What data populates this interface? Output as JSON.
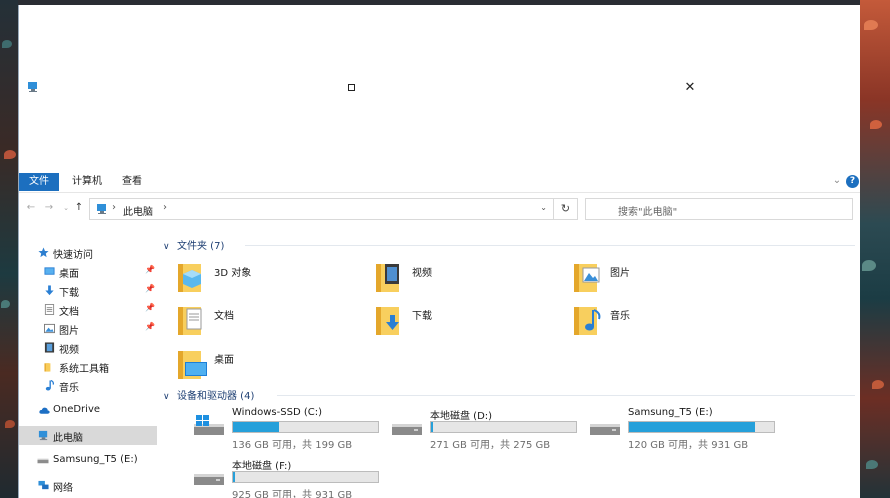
{
  "window": {
    "close_glyph": "✕"
  },
  "ribbon": {
    "tabs": [
      "文件",
      "计算机",
      "查看"
    ],
    "help_glyph": "?",
    "collapse_glyph": "⌄"
  },
  "address_bar": {
    "location": "此电脑",
    "separator": "›",
    "dropdown_glyph": "⌄",
    "refresh_glyph": "↻",
    "back_glyph": "←",
    "forward_glyph": "→",
    "history_glyph": "⌄",
    "up_glyph": "↑"
  },
  "search": {
    "placeholder": "搜索\"此电脑\""
  },
  "sidebar": {
    "pin_glyph": "📌",
    "items": [
      {
        "label": "快速访问",
        "icon": "star-icon",
        "pinned": false
      },
      {
        "label": "桌面",
        "icon": "desktop-icon",
        "pinned": true
      },
      {
        "label": "下载",
        "icon": "download-icon",
        "pinned": true
      },
      {
        "label": "文档",
        "icon": "document-icon",
        "pinned": true
      },
      {
        "label": "图片",
        "icon": "pictures-icon",
        "pinned": true
      },
      {
        "label": "视频",
        "icon": "video-icon",
        "pinned": false
      },
      {
        "label": "系统工具箱",
        "icon": "folder-icon",
        "pinned": false
      },
      {
        "label": "音乐",
        "icon": "music-icon",
        "pinned": false
      },
      {
        "label": "OneDrive",
        "icon": "cloud-icon",
        "pinned": false
      },
      {
        "label": "此电脑",
        "icon": "computer-icon",
        "pinned": false,
        "selected": true
      },
      {
        "label": "Samsung_T5 (E:)",
        "icon": "usb-drive-icon",
        "pinned": false
      },
      {
        "label": "网络",
        "icon": "network-icon",
        "pinned": false
      }
    ]
  },
  "folders_group": {
    "header": "文件夹 (7)",
    "chevron": "∨",
    "items": [
      {
        "label": "3D 对象",
        "icon": "3d-objects-icon"
      },
      {
        "label": "视频",
        "icon": "video-folder-icon"
      },
      {
        "label": "图片",
        "icon": "pictures-folder-icon"
      },
      {
        "label": "文档",
        "icon": "documents-folder-icon"
      },
      {
        "label": "下载",
        "icon": "downloads-folder-icon"
      },
      {
        "label": "音乐",
        "icon": "music-folder-icon"
      },
      {
        "label": "桌面",
        "icon": "desktop-folder-icon"
      }
    ]
  },
  "drives_group": {
    "header": "设备和驱动器 (4)",
    "chevron": "∨",
    "items": [
      {
        "name": "Windows-SSD (C:)",
        "space": "136 GB 可用，共 199 GB",
        "used_fraction": 0.317,
        "icon": "windows-drive-icon"
      },
      {
        "name": "本地磁盘 (D:)",
        "space": "271 GB 可用，共 275 GB",
        "used_fraction": 0.015,
        "icon": "hard-drive-icon"
      },
      {
        "name": "Samsung_T5 (E:)",
        "space": "120 GB 可用，共 931 GB",
        "used_fraction": 0.871,
        "icon": "hard-drive-icon"
      },
      {
        "name": "本地磁盘 (F:)",
        "space": "925 GB 可用，共 931 GB",
        "used_fraction": 0.006,
        "icon": "hard-drive-icon"
      }
    ]
  },
  "colors": {
    "accent": "#1c6fbf",
    "drive_fill": "#26a0da",
    "group_header": "#1e3f73",
    "selection": "#d9d9d9"
  }
}
